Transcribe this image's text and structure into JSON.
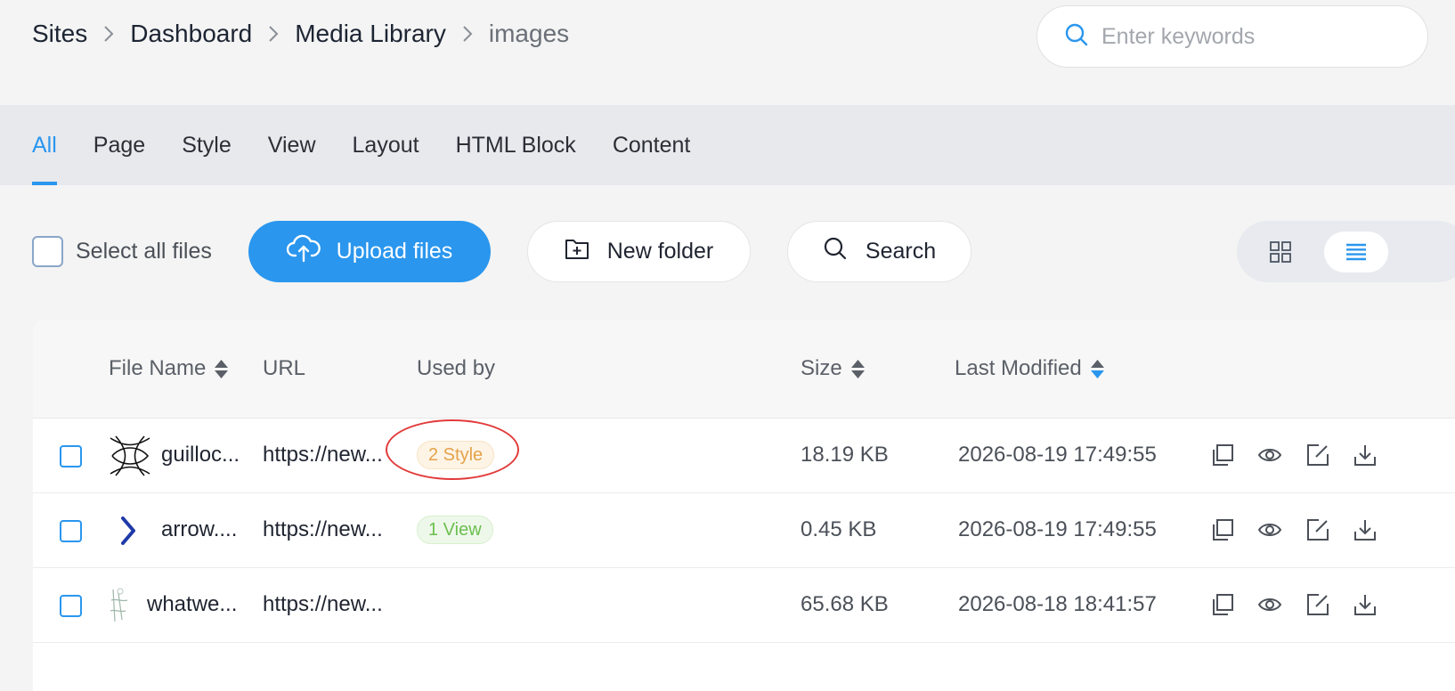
{
  "breadcrumb": [
    "Sites",
    "Dashboard",
    "Media Library",
    "images"
  ],
  "search": {
    "placeholder": "Enter keywords"
  },
  "tabs": [
    "All",
    "Page",
    "Style",
    "View",
    "Layout",
    "HTML Block",
    "Content"
  ],
  "toolbar": {
    "select_all": "Select all files",
    "upload": "Upload files",
    "new_folder": "New folder",
    "search": "Search"
  },
  "table": {
    "headers": {
      "file_name": "File Name",
      "url": "URL",
      "used_by": "Used by",
      "size": "Size",
      "last_modified": "Last Modified"
    },
    "rows": [
      {
        "name": "guilloc...",
        "url": "https://new...",
        "used_by": "2 Style",
        "size": "18.19 KB",
        "modified": "2026-08-19 17:49:55"
      },
      {
        "name": "arrow....",
        "url": "https://new...",
        "used_by": "1 View",
        "size": "0.45 KB",
        "modified": "2026-08-19 17:49:55"
      },
      {
        "name": "whatwe...",
        "url": "https://new...",
        "used_by": "",
        "size": "65.68 KB",
        "modified": "2026-08-18 18:41:57"
      }
    ]
  },
  "colors": {
    "accent": "#2a96ee",
    "badge_style": "#e5a24a",
    "badge_view": "#6bbf4e",
    "annotation": "#e23b3b"
  },
  "icons": [
    "chevron-right-icon",
    "search-icon",
    "upload-cloud-icon",
    "folder-plus-icon",
    "grid-view-icon",
    "list-view-icon",
    "sort-icon",
    "copy-icon",
    "eye-icon",
    "edit-icon",
    "download-icon"
  ]
}
